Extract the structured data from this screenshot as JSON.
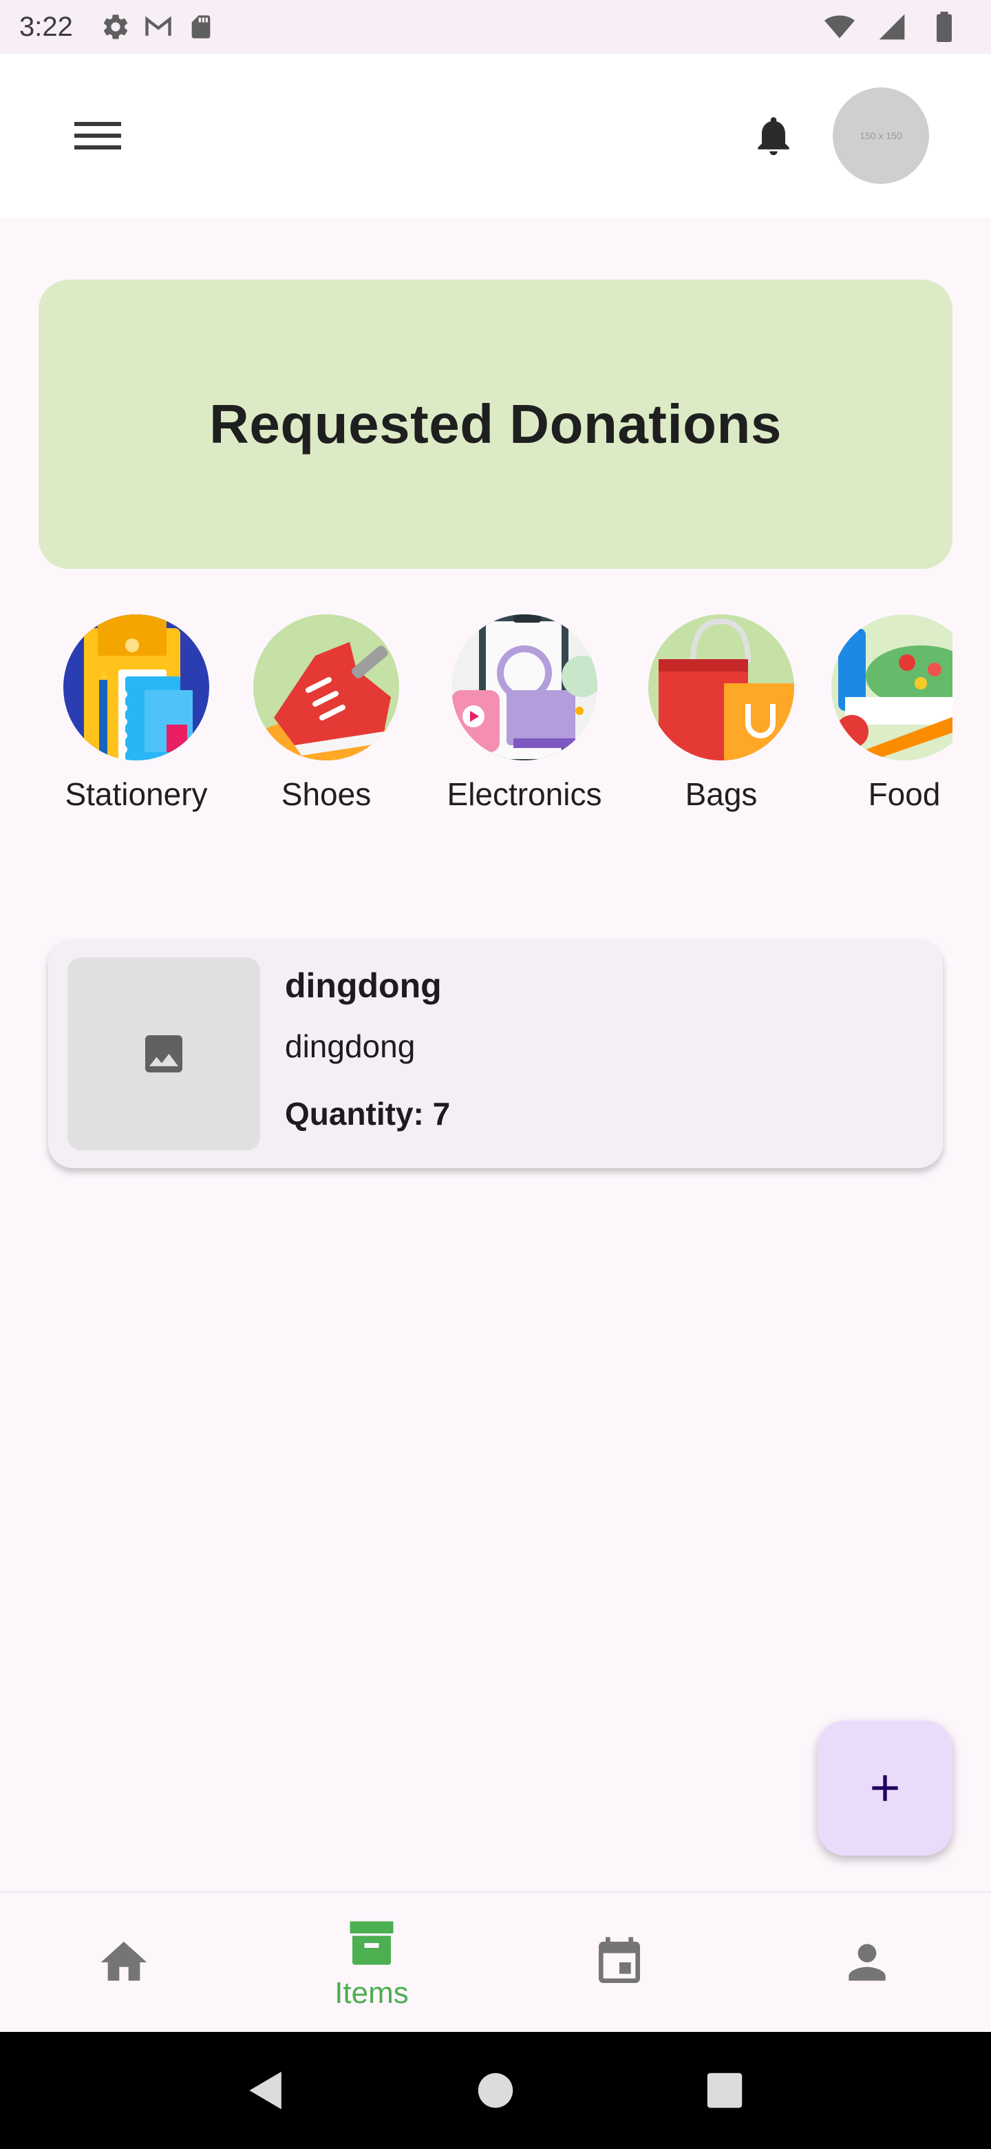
{
  "status_bar": {
    "time": "3:22",
    "icons": [
      "settings-icon",
      "gmail-icon",
      "sd-card-icon",
      "wifi-icon",
      "signal-icon",
      "battery-icon"
    ]
  },
  "app_bar": {
    "menu_icon": "menu-icon",
    "notification_icon": "bell-icon",
    "avatar_placeholder": "150 x 150"
  },
  "banner": {
    "title": "Requested Donations",
    "background": "#dcebc6"
  },
  "categories": [
    {
      "label": "Stationery",
      "image": "stationery"
    },
    {
      "label": "Shoes",
      "image": "shoes"
    },
    {
      "label": "Electronics",
      "image": "electronics"
    },
    {
      "label": "Bags",
      "image": "bags"
    },
    {
      "label": "Food",
      "image": "food"
    }
  ],
  "items": [
    {
      "title": "dingdong",
      "description": "dingdong",
      "quantity_text": "Quantity: 7",
      "thumbnail": "image-placeholder-icon"
    }
  ],
  "fab": {
    "icon": "plus-icon",
    "background": "#eadbfb"
  },
  "bottom_nav": {
    "active_color": "#4caf50",
    "items": [
      {
        "icon": "home-icon",
        "label": ""
      },
      {
        "icon": "archive-icon",
        "label": "Items",
        "active": true
      },
      {
        "icon": "calendar-icon",
        "label": ""
      },
      {
        "icon": "person-icon",
        "label": ""
      }
    ]
  },
  "system_nav": {
    "icons": [
      "back-icon",
      "home-circle-icon",
      "recents-icon"
    ]
  }
}
